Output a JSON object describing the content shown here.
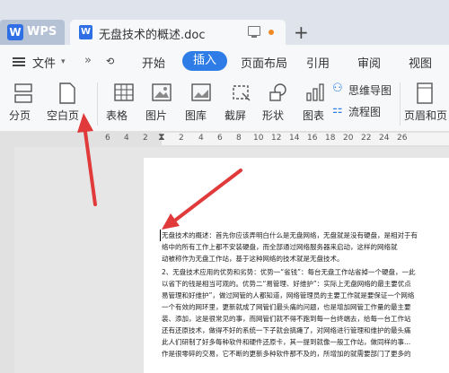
{
  "tabs": {
    "wps_logo": "W",
    "wps_label": "WPS",
    "doc_icon": "W",
    "doc_title": "无盘技术的概述.doc",
    "new_tab": "+"
  },
  "menu": {
    "file": "文件",
    "more": "»",
    "items": [
      "开始",
      "插入",
      "页面布局",
      "引用",
      "审阅",
      "视图"
    ]
  },
  "ribbon": {
    "page_break": "分页",
    "blank_page": "空白页",
    "table": "表格",
    "picture": "图片",
    "gallery": "图库",
    "screenshot": "截屏",
    "shapes": "形状",
    "chart": "图表",
    "mind_map": "思维导图",
    "flowchart": "流程图",
    "header_footer": "页眉和页"
  },
  "ruler": [
    "6",
    "4",
    "2",
    "2",
    "4",
    "6",
    "8",
    "10",
    "12",
    "14",
    "16",
    "18",
    "20",
    "22",
    "24",
    "26"
  ],
  "document": {
    "lines": [
      "无盘技术的概述：首先你应该弄明白什么是无盘网络，无盘就是没有硬盘，是相对于有",
      "络中的所有工作上都不安装硬盘，而全部通过网络服务器来启动，这样的网络就",
      "动被称作为无盘工作站，基于这种网络的技术就是无盘技术。",
      "2、无盘技术应用的优势和劣势：优势一“省钱”：每台无盘工作站省掉一个硬盘，一此",
      "以省下的钱是相当可观的。优势二“易管理、好维护”：实际上无盘网络的最主要优点",
      "易管理和好维护”，做过网管的人都知道，网络管理员的主要工作就是要保证一个网络",
      "一个有效的网环里，更新就成了网管们最头痛的问题，也是增加网管工作量的最主要",
      "装、添加，这是很常见的事，而网管们就不得不跑到每一台终端去，给每一台工作站",
      "还有还原技术，做得不好的系统一下子就会搞瘫了，对网络进行管理和维护的最头痛",
      "此人们研制了好多每种软件和硬件还原卡，其一提到就像一般工作站，做同样的事...",
      "作是很零碎的交易，它不断的更新多种软件那不及的，所增加的就需要部门了更多的"
    ]
  }
}
